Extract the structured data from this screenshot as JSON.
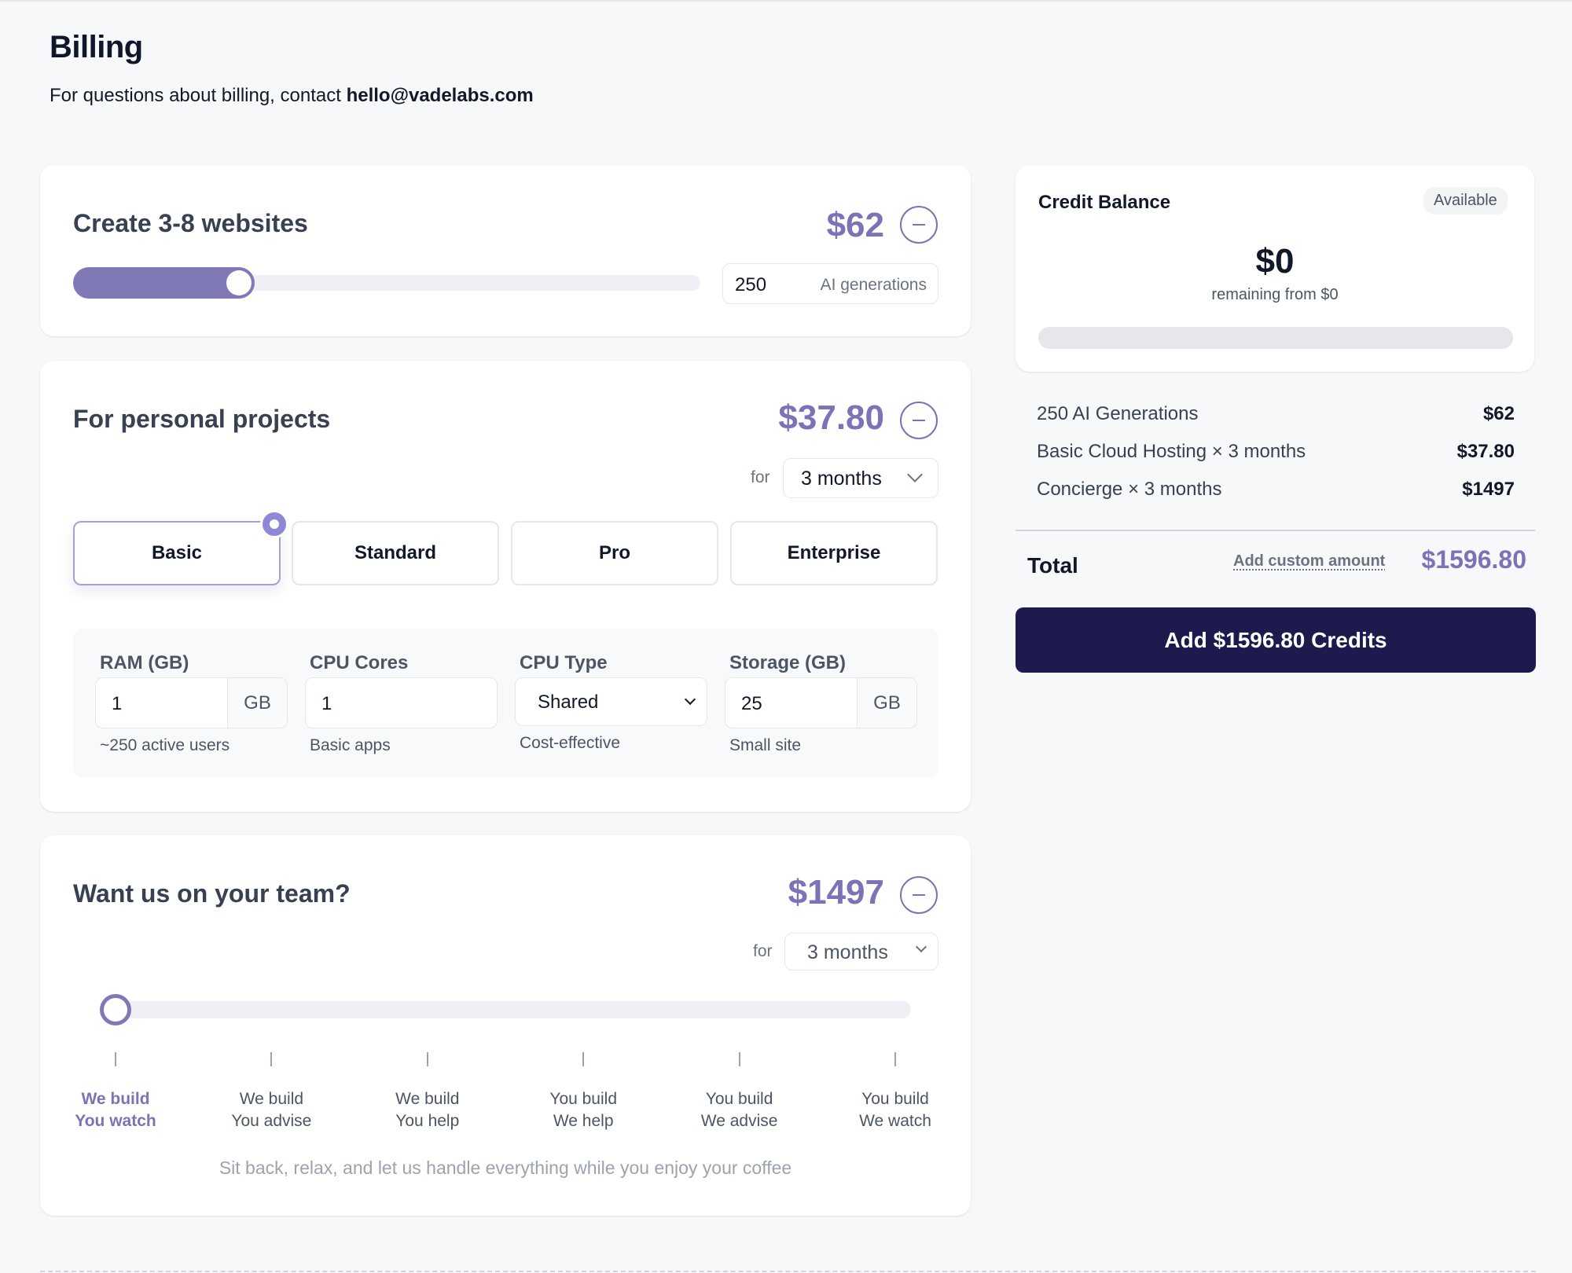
{
  "header": {
    "title": "Billing",
    "contact_prefix": "For questions about billing, contact ",
    "contact_email": "hello@vadelabs.com"
  },
  "websites": {
    "title": "Create 3-8 websites",
    "price": "$62",
    "generations_value": "250",
    "generations_unit": "AI generations",
    "slider_fraction": 0.29
  },
  "hosting": {
    "title": "For personal projects",
    "price": "$37.80",
    "for_label": "for",
    "duration": "3 months",
    "tiers": [
      "Basic",
      "Standard",
      "Pro",
      "Enterprise"
    ],
    "selected_tier": "Basic",
    "specs": {
      "ram": {
        "label": "RAM (GB)",
        "value": "1",
        "unit": "GB",
        "hint": "~250 active users"
      },
      "cpu_cores": {
        "label": "CPU Cores",
        "value": "1",
        "hint": "Basic apps"
      },
      "cpu_type": {
        "label": "CPU Type",
        "value": "Shared",
        "hint": "Cost-effective"
      },
      "storage": {
        "label": "Storage (GB)",
        "value": "25",
        "unit": "GB",
        "hint": "Small site"
      }
    }
  },
  "concierge": {
    "title": "Want us on your team?",
    "price": "$1497",
    "for_label": "for",
    "duration": "3 months",
    "steps": [
      {
        "line1": "We build",
        "line2": "You watch"
      },
      {
        "line1": "We build",
        "line2": "You advise"
      },
      {
        "line1": "We build",
        "line2": "You help"
      },
      {
        "line1": "You build",
        "line2": "We help"
      },
      {
        "line1": "You build",
        "line2": "We advise"
      },
      {
        "line1": "You build",
        "line2": "We watch"
      }
    ],
    "selected_step": 0,
    "description": "Sit back, relax, and let us handle everything while you enjoy your coffee"
  },
  "credit_balance": {
    "title": "Credit Balance",
    "badge": "Available",
    "amount": "$0",
    "remaining_text": "remaining from $0",
    "used_fraction": 0
  },
  "summary": {
    "lines": [
      {
        "label": "250 AI Generations",
        "amount": "$62"
      },
      {
        "label": "Basic Cloud Hosting × 3 months",
        "amount": "$37.80"
      },
      {
        "label": "Concierge × 3 months",
        "amount": "$1497"
      }
    ],
    "total_label": "Total",
    "custom_amount_link": "Add custom amount",
    "total_amount": "$1596.80",
    "cta_label": "Add $1596.80 Credits"
  },
  "colors": {
    "accent": "#7c72b5",
    "cta": "#1d1a4d",
    "background": "#f7f8fa"
  }
}
